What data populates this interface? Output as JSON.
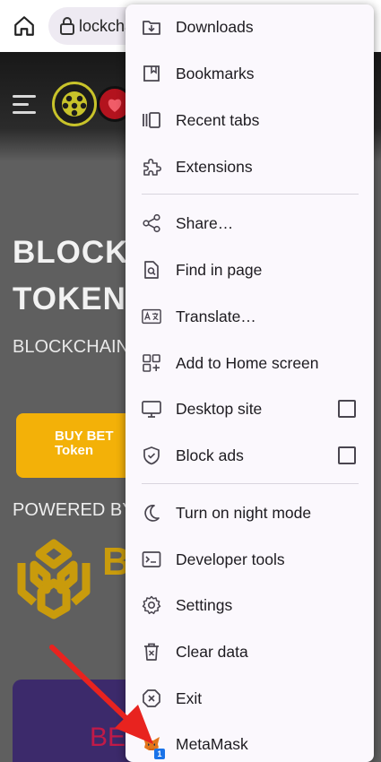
{
  "browser": {
    "url": "lockcha"
  },
  "site": {
    "hero_title": "BLOCKC TOKEN",
    "hero_subtitle": "BLOCKCHAIN",
    "buy_button": "BUY BET Token",
    "powered_by": "POWERED BY",
    "bnb_text": "B S",
    "card_text": "BE"
  },
  "menu": {
    "items": [
      {
        "label": "Downloads",
        "icon": "download-icon"
      },
      {
        "label": "Bookmarks",
        "icon": "bookmark-icon"
      },
      {
        "label": "Recent tabs",
        "icon": "recent-tabs-icon"
      },
      {
        "label": "Extensions",
        "icon": "puzzle-icon"
      },
      {
        "label": "Share…",
        "icon": "share-icon"
      },
      {
        "label": "Find in page",
        "icon": "find-in-page-icon"
      },
      {
        "label": "Translate…",
        "icon": "translate-icon"
      },
      {
        "label": "Add to Home screen",
        "icon": "add-to-home-icon"
      },
      {
        "label": "Desktop site",
        "icon": "desktop-icon",
        "checked": false
      },
      {
        "label": "Block ads",
        "icon": "shield-icon",
        "checked": false
      },
      {
        "label": "Turn on night mode",
        "icon": "moon-icon"
      },
      {
        "label": "Developer tools",
        "icon": "terminal-icon"
      },
      {
        "label": "Settings",
        "icon": "gear-icon"
      },
      {
        "label": "Clear data",
        "icon": "trash-icon"
      },
      {
        "label": "Exit",
        "icon": "close-circle-icon"
      },
      {
        "label": "MetaMask",
        "icon": "metamask-fox-icon",
        "badge": "1"
      }
    ]
  },
  "colors": {
    "menu_bg": "#fbf8fd",
    "buy_button": "#f3b108",
    "arrow": "#e8231f"
  }
}
